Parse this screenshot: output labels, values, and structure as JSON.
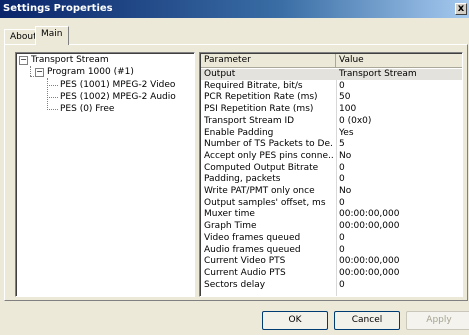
{
  "window": {
    "title": "Settings Properties",
    "close_glyph": "x"
  },
  "tabs": [
    {
      "label": "About"
    },
    {
      "label": "Main"
    }
  ],
  "tree": {
    "root": {
      "label": "Transport Stream",
      "expander": "−"
    },
    "program": {
      "label": "Program 1000 (#1)",
      "expander": "−"
    },
    "streams": [
      {
        "label": "PES (1001) MPEG-2 Video"
      },
      {
        "label": "PES (1002) MPEG-2 Audio"
      },
      {
        "label": "PES (0) Free"
      }
    ]
  },
  "grid": {
    "columns": {
      "parameter": "Parameter",
      "value": "Value"
    },
    "rows": [
      {
        "parameter": "Output",
        "value": "Transport Stream"
      },
      {
        "parameter": "Required Bitrate, bit/s",
        "value": " 0"
      },
      {
        "parameter": "PCR Repetition Rate (ms)",
        "value": "50"
      },
      {
        "parameter": "PSI Repetition Rate (ms)",
        "value": "100"
      },
      {
        "parameter": "Transport Stream ID",
        "value": "0 (0x0)"
      },
      {
        "parameter": "Enable Padding",
        "value": "Yes"
      },
      {
        "parameter": "Number of TS Packets to De...",
        "value": "5"
      },
      {
        "parameter": "Accept only PES pins conne...",
        "value": "No"
      },
      {
        "parameter": "Computed Output Bitrate",
        "value": " 0"
      },
      {
        "parameter": "Padding, packets",
        "value": "0"
      },
      {
        "parameter": "Write PAT/PMT only once",
        "value": "No"
      },
      {
        "parameter": "Output samples' offset, ms",
        "value": "0"
      },
      {
        "parameter": "Muxer time",
        "value": " 00:00:00,000"
      },
      {
        "parameter": "Graph Time",
        "value": " 00:00:00,000"
      },
      {
        "parameter": "Video frames queued",
        "value": "0"
      },
      {
        "parameter": "Audio frames queued",
        "value": "0"
      },
      {
        "parameter": "Current Video PTS",
        "value": " 00:00:00,000"
      },
      {
        "parameter": "Current Audio PTS",
        "value": " 00:00:00,000"
      },
      {
        "parameter": "Sectors delay",
        "value": "0"
      }
    ]
  },
  "buttons": {
    "ok": "OK",
    "cancel": "Cancel",
    "apply": "Apply"
  }
}
